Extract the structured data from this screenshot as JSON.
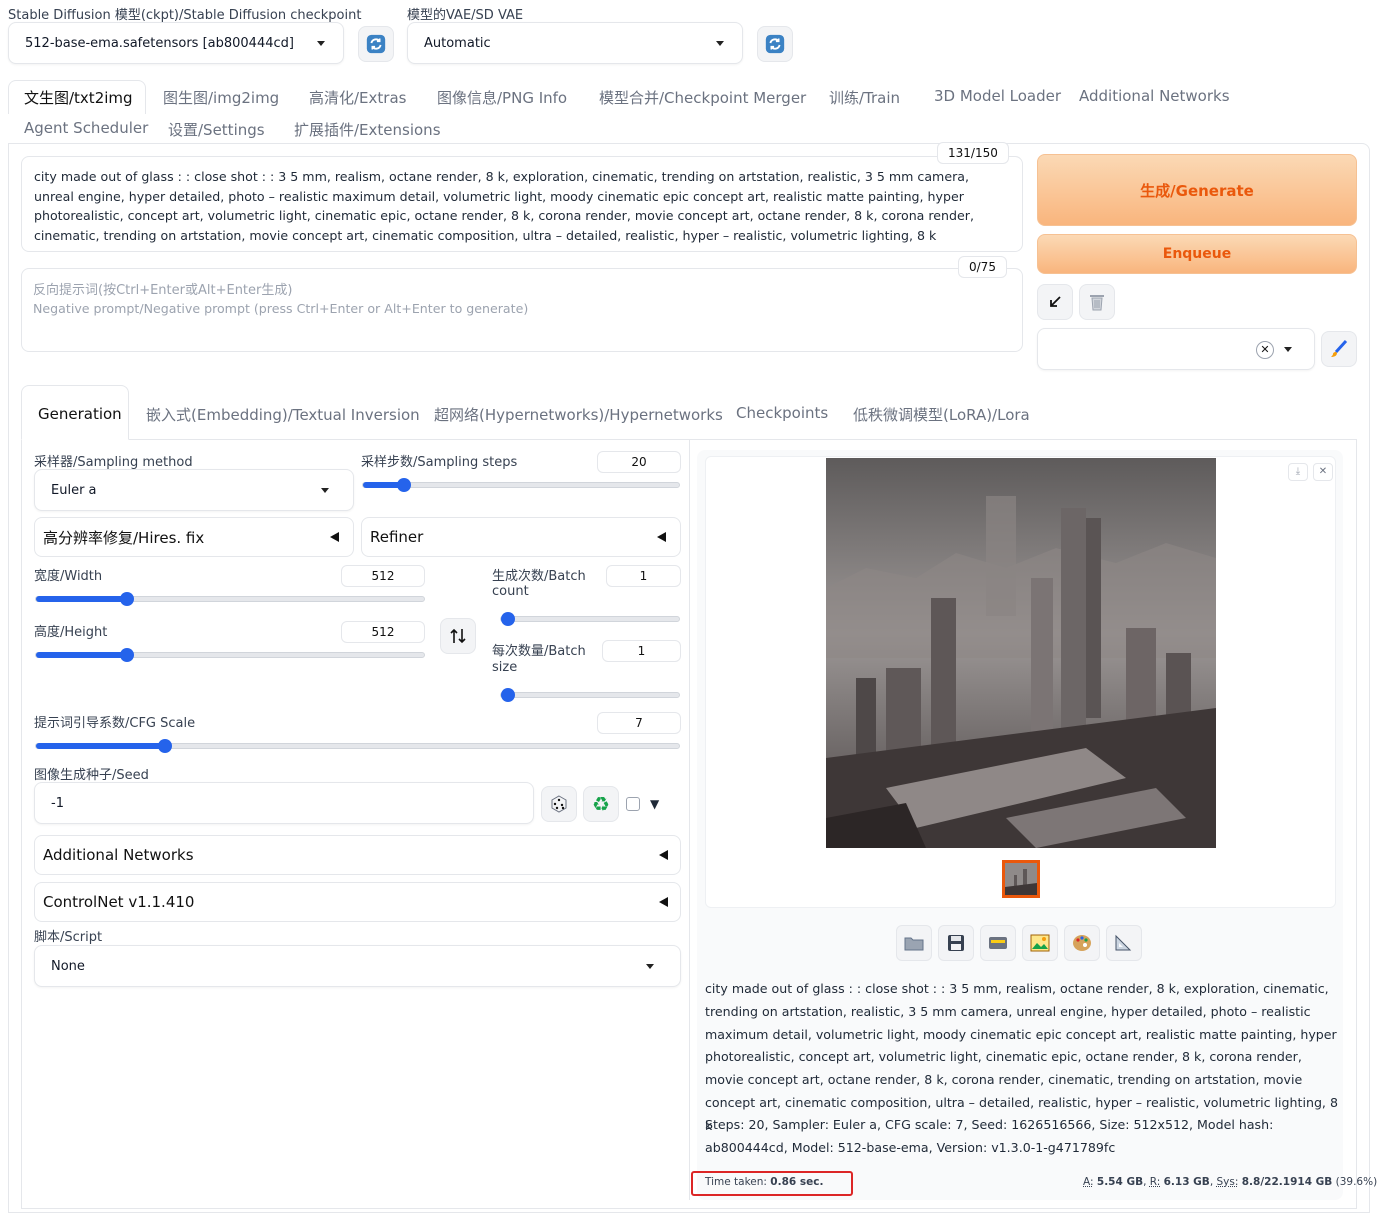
{
  "top": {
    "checkpoint_label": "Stable Diffusion 模型(ckpt)/Stable Diffusion checkpoint",
    "checkpoint_value": "512-base-ema.safetensors [ab800444cd]",
    "vae_label": "模型的VAE/SD VAE",
    "vae_value": "Automatic"
  },
  "tabs": [
    {
      "label": "文生图/txt2img"
    },
    {
      "label": "图生图/img2img"
    },
    {
      "label": "高清化/Extras"
    },
    {
      "label": "图像信息/PNG Info"
    },
    {
      "label": "模型合并/Checkpoint Merger"
    },
    {
      "label": "训练/Train"
    },
    {
      "label": "3D Model Loader"
    },
    {
      "label": "Additional Networks"
    },
    {
      "label": "Agent Scheduler"
    },
    {
      "label": "设置/Settings"
    },
    {
      "label": "扩展插件/Extensions"
    }
  ],
  "prompt": {
    "text": "city made out of glass : : close shot : : 3 5 mm, realism, octane render, 8 k, exploration, cinematic, trending on artstation, realistic, 3 5 mm camera, unreal engine, hyper detailed, photo – realistic maximum detail, volumetric light, moody cinematic epic concept art, realistic matte painting, hyper photorealistic, concept art, volumetric light, cinematic epic, octane render, 8 k, corona render, movie concept art, octane render, 8 k, corona render, cinematic, trending on artstation, movie concept art, cinematic composition, ultra – detailed, realistic, hyper – realistic, volumetric lighting, 8 k",
    "counter": "131/150"
  },
  "negative": {
    "placeholder_line1": "反向提示词(按Ctrl+Enter或Alt+Enter生成)",
    "placeholder_line2": "Negative prompt/Negative prompt (press Ctrl+Enter or Alt+Enter to generate)",
    "counter": "0/75"
  },
  "actions": {
    "generate": "生成/Generate",
    "enqueue": "Enqueue"
  },
  "subtabs": [
    {
      "label": "Generation"
    },
    {
      "label": "嵌入式(Embedding)/Textual Inversion"
    },
    {
      "label": "超网络(Hypernetworks)/Hypernetworks"
    },
    {
      "label": "Checkpoints"
    },
    {
      "label": "低秩微调模型(LoRA)/Lora"
    }
  ],
  "gen": {
    "sampler_label": "采样器/Sampling method",
    "sampler_value": "Euler a",
    "steps_label": "采样步数/Sampling steps",
    "steps_value": "20",
    "steps_fraction": 0.13,
    "hires_label": "高分辨率修复/Hires. fix",
    "refiner_label": "Refiner",
    "width_label": "宽度/Width",
    "width_value": "512",
    "width_fraction": 0.235,
    "height_label": "高度/Height",
    "height_value": "512",
    "height_fraction": 0.235,
    "batch_count_label_1": "生成次数/Batch",
    "batch_count_label_2": "count",
    "batch_count_value": "1",
    "batch_count_fraction": 0.0,
    "batch_size_label_1": "每次数量/Batch",
    "batch_size_label_2": "size",
    "batch_size_value": "1",
    "batch_size_fraction": 0.0,
    "cfg_label": "提示词引导系数/CFG Scale",
    "cfg_value": "7",
    "cfg_fraction": 0.2,
    "seed_label": "图像生成种子/Seed",
    "seed_value": "-1",
    "additional_networks": "Additional Networks",
    "controlnet": "ControlNet v1.1.410",
    "script_label": "脚本/Script",
    "script_value": "None"
  },
  "output": {
    "info_prompt": "city made out of glass : : close shot : : 3 5 mm, realism, octane render, 8 k, exploration, cinematic, trending on artstation, realistic, 3 5 mm camera, unreal engine, hyper detailed, photo – realistic maximum detail, volumetric light, moody cinematic epic concept art, realistic matte painting, hyper photorealistic, concept art, volumetric light, cinematic epic, octane render, 8 k, corona render, movie concept art, octane render, 8 k, corona render, cinematic, trending on artstation, movie concept art, cinematic composition, ultra – detailed, realistic, hyper – realistic, volumetric lighting, 8 k",
    "info_params": "Steps: 20, Sampler: Euler a, CFG scale: 7, Seed: 1626516566, Size: 512x512, Model hash: ab800444cd, Model: 512-base-ema, Version: v1.3.0-1-g471789fc",
    "time_label": "Time taken:",
    "time_value": "0.86 sec.",
    "vram_a_label": "A:",
    "vram_a": "5.54 GB",
    "vram_r_label": "R:",
    "vram_r": "6.13 GB",
    "vram_sys_label": "Sys:",
    "vram_sys": "8.8/22.1914 GB",
    "vram_pct": "(39.6%)"
  },
  "colors": {
    "accent": "#2563eb",
    "generate_text": "#ea580c",
    "highlight_box": "#dc2626"
  },
  "icons": [
    "refresh-icon",
    "arrow-paste-icon",
    "trash-icon",
    "close-icon",
    "brush-icon",
    "swap-icon",
    "dice-icon",
    "recycle-icon",
    "folder-icon",
    "save-icon",
    "zip-icon",
    "image-icon",
    "palette-icon",
    "ruler-icon",
    "download-icon"
  ]
}
